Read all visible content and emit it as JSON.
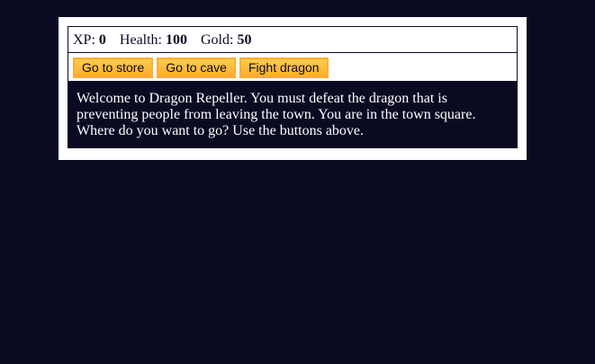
{
  "stats": {
    "xp_label": "XP:",
    "xp_value": "0",
    "health_label": "Health:",
    "health_value": "100",
    "gold_label": "Gold:",
    "gold_value": "50"
  },
  "controls": {
    "button1": "Go to store",
    "button2": "Go to cave",
    "button3": "Fight dragon"
  },
  "text": "Welcome to Dragon Repeller. You must defeat the dragon that is preventing people from leaving the town. You are in the town square. Where do you want to go? Use the buttons above.",
  "colors": {
    "background": "#0a0a23",
    "button": "#feac32",
    "panel": "#ffffff"
  }
}
